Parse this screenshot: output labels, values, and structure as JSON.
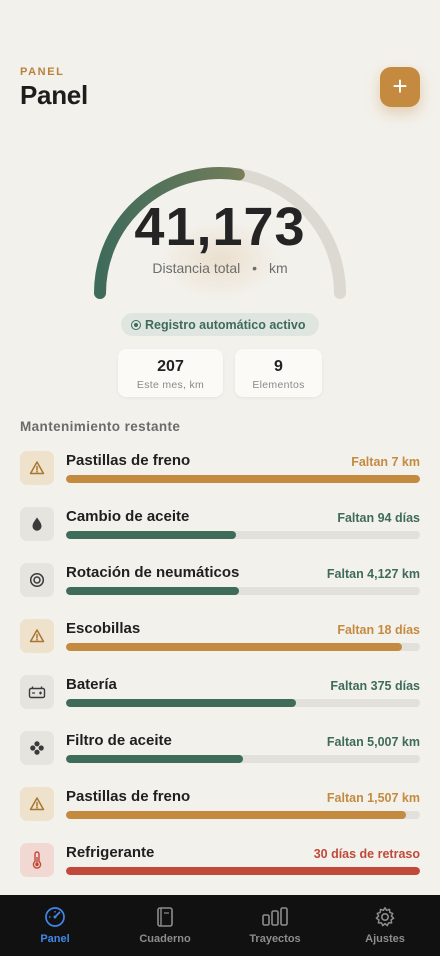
{
  "header": {
    "eyebrow": "PANEL",
    "title": "Panel",
    "add_button_label": "+"
  },
  "gauge": {
    "value": "41,173",
    "caption": "Distancia total",
    "separator": "•",
    "unit": "km",
    "progress_fraction": 0.55
  },
  "auto_log": {
    "label": "Registro automático activo"
  },
  "stats": [
    {
      "value": "207",
      "label": "Este mes, km"
    },
    {
      "value": "9",
      "label": "Elementos"
    }
  ],
  "maintenance": {
    "title": "Mantenimiento restante",
    "items": [
      {
        "name": "Pastillas de freno",
        "status": "Faltan 7 km",
        "progress": 1.0,
        "tone": "warn",
        "icon": "warning-icon"
      },
      {
        "name": "Cambio de aceite",
        "status": "Faltan 94 días",
        "progress": 0.48,
        "tone": "ok",
        "icon": "oil-drop-icon"
      },
      {
        "name": "Rotación de neumáticos",
        "status": "Faltan 4,127 km",
        "progress": 0.49,
        "tone": "ok",
        "icon": "tire-icon"
      },
      {
        "name": "Escobillas",
        "status": "Faltan 18 días",
        "progress": 0.95,
        "tone": "warn",
        "icon": "warning-icon"
      },
      {
        "name": "Batería",
        "status": "Faltan 375 días",
        "progress": 0.65,
        "tone": "ok",
        "icon": "battery-icon"
      },
      {
        "name": "Filtro de aceite",
        "status": "Faltan 5,007 km",
        "progress": 0.5,
        "tone": "ok",
        "icon": "filter-icon"
      },
      {
        "name": "Pastillas de freno",
        "status": "Faltan 1,507 km",
        "progress": 0.96,
        "tone": "warn",
        "icon": "warning-icon"
      },
      {
        "name": "Refrigerante",
        "status": "30 días de retraso",
        "progress": 1.0,
        "tone": "overdue",
        "icon": "thermometer-icon"
      }
    ]
  },
  "tabs": [
    {
      "label": "Panel",
      "icon": "gauge-icon",
      "active": true
    },
    {
      "label": "Cuaderno",
      "icon": "notebook-icon",
      "active": false
    },
    {
      "label": "Trayectos",
      "icon": "bars-icon",
      "active": false
    },
    {
      "label": "Ajustes",
      "icon": "gear-icon",
      "active": false
    }
  ],
  "colors": {
    "accent": "#c48a3f",
    "ok": "#3f6b5b",
    "warn": "#c48a3f",
    "overdue": "#c0493a",
    "tab_active": "#3f88e8"
  }
}
